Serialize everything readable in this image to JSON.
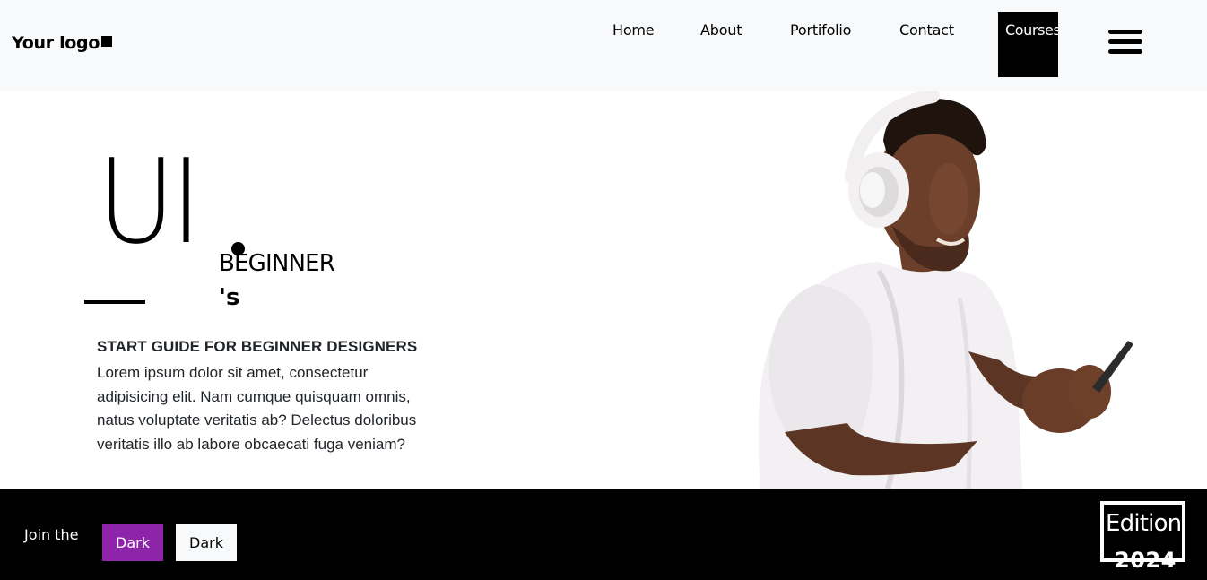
{
  "header": {
    "logo_text": "Your logo",
    "nav": {
      "home": "Home",
      "about": "About",
      "portfolio": "Portifolio",
      "contact": "Contact",
      "courses": "Courses"
    },
    "menu_icon": "hamburger-menu-icon"
  },
  "hero": {
    "big_text": "UI",
    "beginner": "BEGINNER",
    "possessive": "'s",
    "guide_title": "START GUIDE FOR BEGINNER DESIGNERS",
    "guide_body": "Lorem ipsum dolor sit amet, consectetur adipisicing elit. Nam cumque quisquam omnis, natus voluptate veritatis ab? Delectus doloribus veritatis illo ab labore obcaecati fuga veniam?",
    "photo": "man-with-headphones-using-phone"
  },
  "footer": {
    "join_text": "Join the",
    "btn_dark_purple": "Dark",
    "btn_dark_light": "Dark",
    "edition_label": "Edition",
    "edition_year": "2024"
  },
  "colors": {
    "header_bg": "#f8f9fa",
    "footer_bg": "#000000",
    "accent_purple": "#8e24aa",
    "courses_bg": "#000000"
  }
}
